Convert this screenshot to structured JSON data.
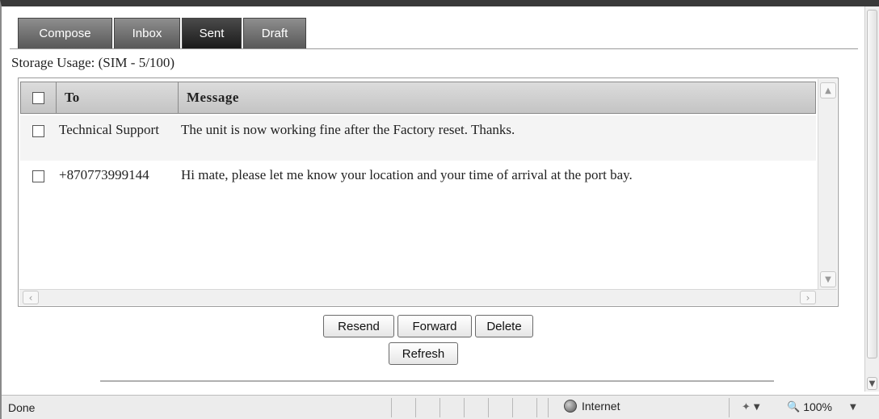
{
  "tabs": [
    {
      "label": "Compose",
      "active": false
    },
    {
      "label": "Inbox",
      "active": false
    },
    {
      "label": "Sent",
      "active": true
    },
    {
      "label": "Draft",
      "active": false
    }
  ],
  "storage_usage": "Storage Usage: (SIM - 5/100)",
  "table": {
    "columns": [
      "To",
      "Message"
    ],
    "rows": [
      {
        "to": "Technical Support",
        "message": "The unit is now working fine after the Factory reset. Thanks."
      },
      {
        "to": "+870773999144",
        "message": "Hi mate, please let me know your location and your time of arrival at the port bay."
      }
    ]
  },
  "buttons": {
    "resend": "Resend",
    "forward": "Forward",
    "delete": "Delete",
    "refresh": "Refresh"
  },
  "status_bar": {
    "text": "Done",
    "zone": "Internet",
    "zoom": "100%",
    "icons": [
      "globe-icon",
      "protected-mode-icon",
      "zoom-icon"
    ]
  },
  "colors": {
    "tab_active": "#1a1a1a",
    "tab_inactive": "#585858"
  }
}
